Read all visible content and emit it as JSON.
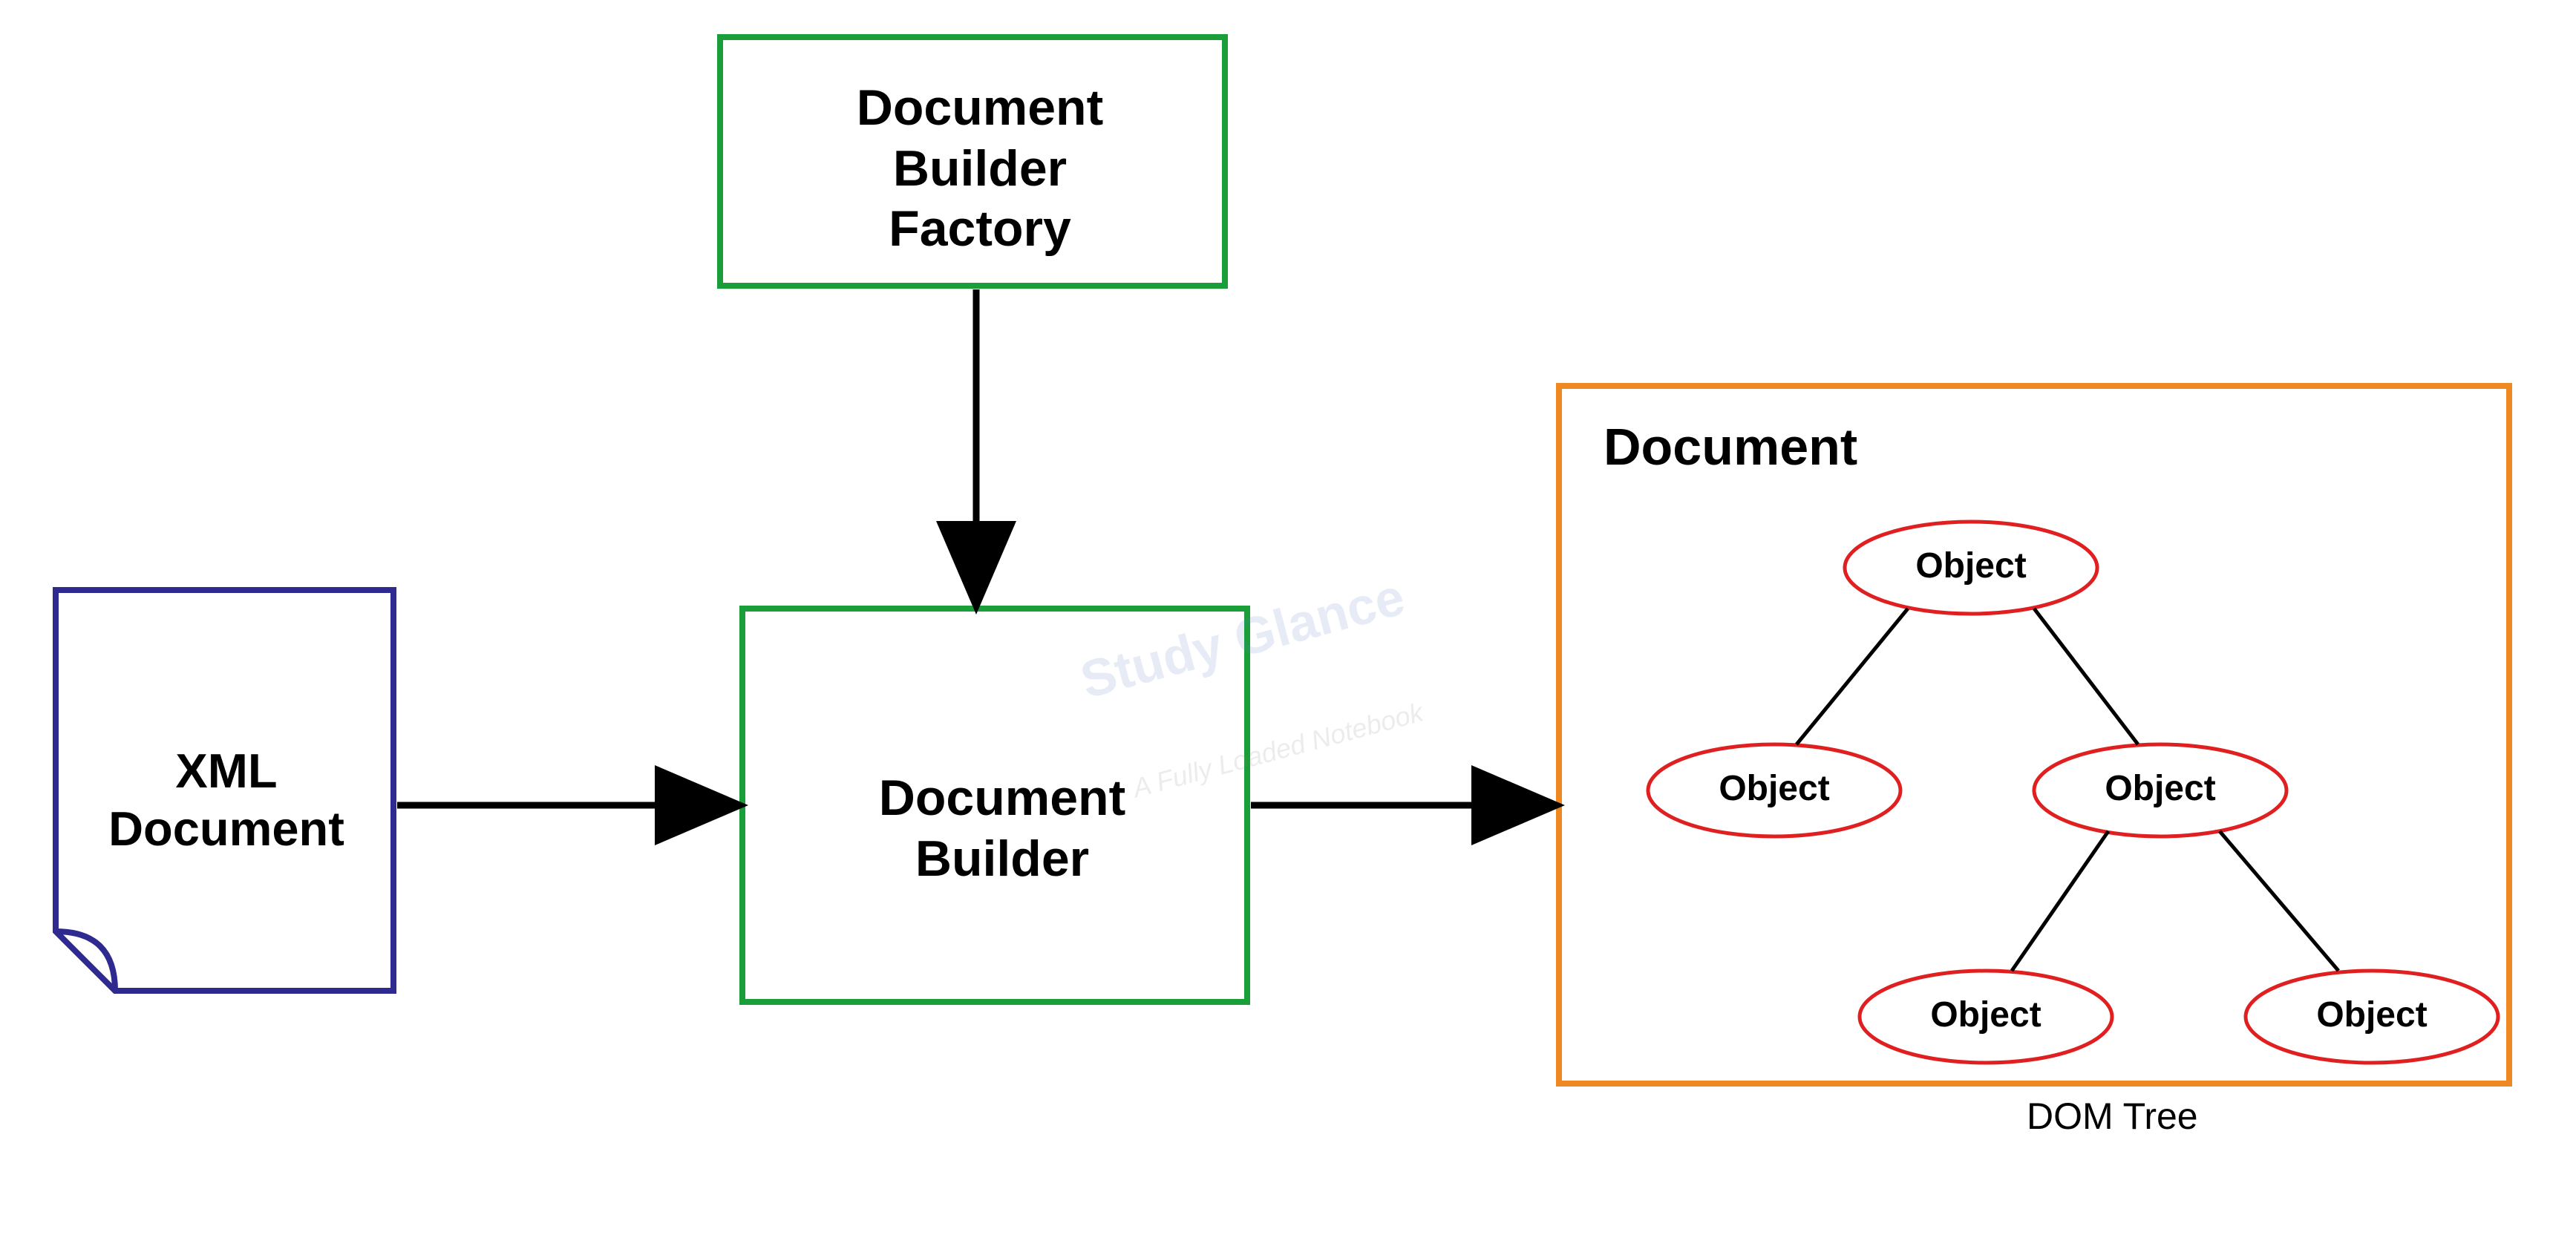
{
  "nodes": {
    "xml_document": "XML\nDocument",
    "factory": "Document\nBuilder\nFactory",
    "builder": "Document\nBuilder",
    "document_title": "Document",
    "dom_tree_label": "DOM Tree"
  },
  "tree_objects": {
    "root": "Object",
    "l1_left": "Object",
    "l1_right": "Object",
    "l2_left": "Object",
    "l2_right": "Object"
  },
  "watermark": {
    "main": "Study Glance",
    "sub": "A Fully Loaded Notebook"
  },
  "colors": {
    "xml_border": "#2e2a8f",
    "green_border": "#1a9e3a",
    "orange_border": "#ee8822",
    "red_ellipse": "#e02020",
    "arrow": "#000000"
  }
}
